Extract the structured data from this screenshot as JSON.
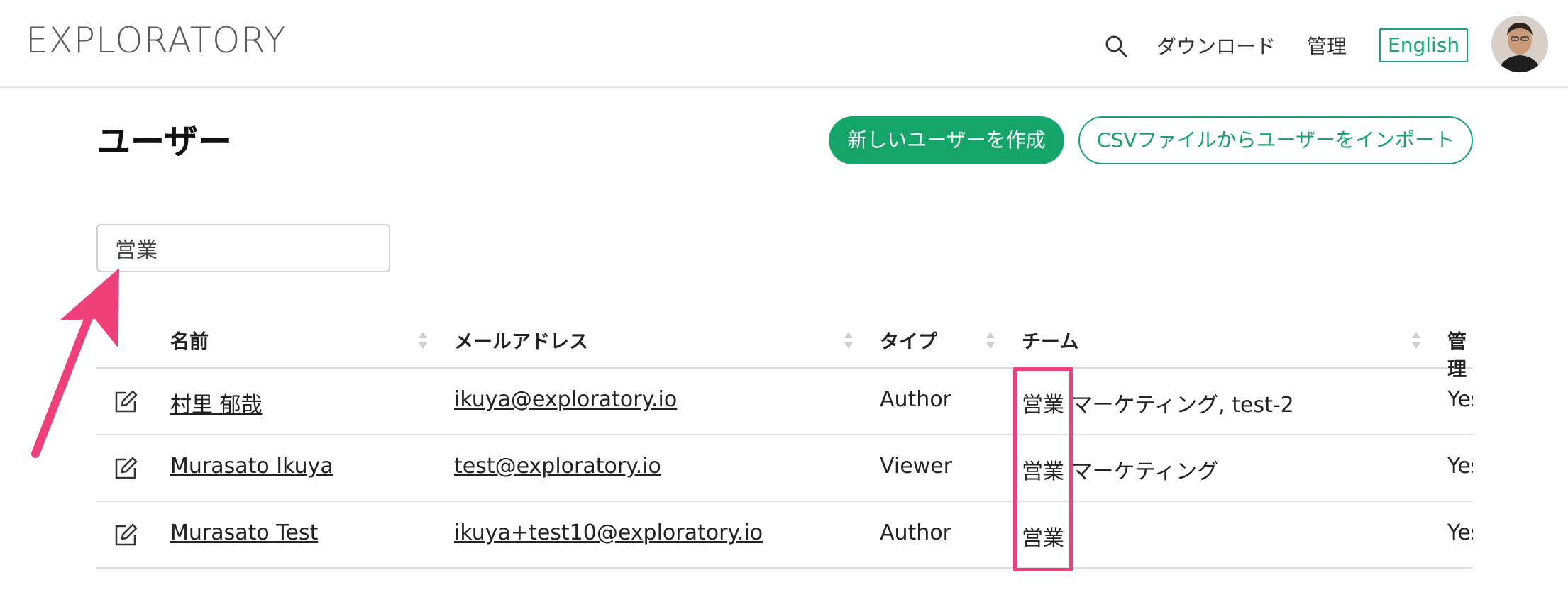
{
  "header": {
    "logo": "EXPLORATORY",
    "download_label": "ダウンロード",
    "admin_label": "管理",
    "language_label": "English"
  },
  "page": {
    "title": "ユーザー",
    "create_button": "新しいユーザーを作成",
    "import_button": "CSVファイルからユーザーをインポート"
  },
  "search": {
    "value": "営業"
  },
  "table": {
    "columns": [
      "名前",
      "メールアドレス",
      "タイプ",
      "チーム",
      "管理"
    ],
    "rows": [
      {
        "name": "村里 郁哉",
        "email": "ikuya@exploratory.io",
        "type": "Author",
        "team_highlight": "営業",
        "team_rest": "マーケティング, test-2",
        "admin": "Yes"
      },
      {
        "name": "Murasato Ikuya",
        "email": "test@exploratory.io",
        "type": "Viewer",
        "team_highlight": "営業",
        "team_rest": "マーケティング",
        "admin": "Yes"
      },
      {
        "name": "Murasato Test",
        "email": "ikuya+test10@exploratory.io",
        "type": "Author",
        "team_highlight": "営業",
        "team_rest": "",
        "admin": "Yes"
      }
    ]
  },
  "colors": {
    "accent": "#15a56a",
    "annotation": "#f0407a"
  },
  "icons": [
    "search-icon",
    "edit-icon",
    "sort-icon",
    "avatar"
  ]
}
